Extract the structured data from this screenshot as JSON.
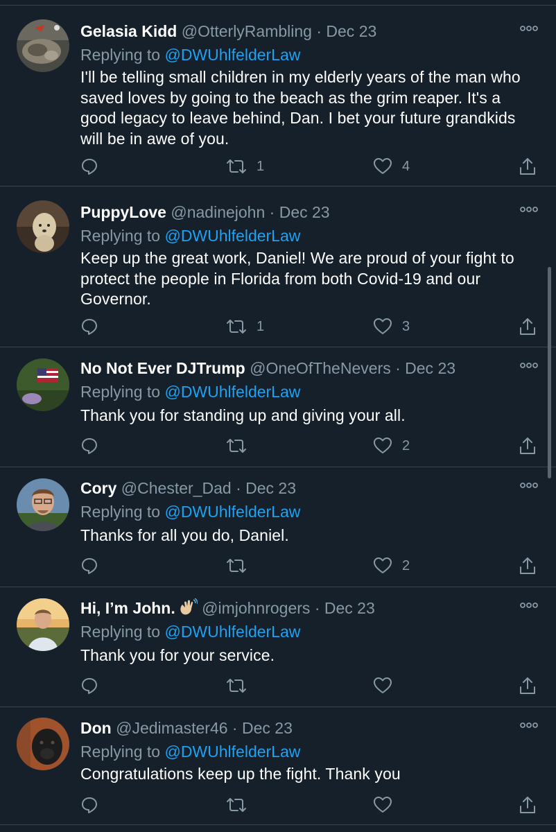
{
  "tweets": [
    {
      "name": "Gelasia Kidd",
      "handle": "@OtterlyRambling",
      "date": "Dec 23",
      "replying_prefix": "Replying to",
      "replying_to": "@DWUhlfelderLaw",
      "text": "I'll be telling small children in my elderly years of the man who saved loves by going to the beach as the grim reaper. It's a good legacy to leave behind, Dan. I bet your future grandkids will be in awe of you.",
      "retweets": "1",
      "likes": "4"
    },
    {
      "name": "PuppyLove",
      "handle": "@nadinejohn",
      "date": "Dec 23",
      "replying_prefix": "Replying to",
      "replying_to": "@DWUhlfelderLaw",
      "text": "Keep up the great work, Daniel! We are proud of your fight to protect the people in Florida from both Covid-19 and our Governor.",
      "retweets": "1",
      "likes": "3"
    },
    {
      "name": "No Not Ever DJTrump",
      "handle": "@OneOfTheNevers",
      "date": "Dec 23",
      "replying_prefix": "Replying to",
      "replying_to": "@DWUhlfelderLaw",
      "text": "Thank you for standing up and giving your all.",
      "retweets": "",
      "likes": "2"
    },
    {
      "name": "Cory",
      "handle": "@Chester_Dad",
      "date": "Dec 23",
      "replying_prefix": "Replying to",
      "replying_to": "@DWUhlfelderLaw",
      "text": "Thanks for all you do, Daniel.",
      "retweets": "",
      "likes": "2"
    },
    {
      "name": "Hi, I’m John.",
      "handle": "@imjohnrogers",
      "date": "Dec 23",
      "replying_prefix": "Replying to",
      "replying_to": "@DWUhlfelderLaw",
      "text": "Thank you for your service.",
      "retweets": "",
      "likes": ""
    },
    {
      "name": "Don",
      "handle": "@Jedimaster46",
      "date": "Dec 23",
      "replying_prefix": "Replying to",
      "replying_to": "@DWUhlfelderLaw",
      "text": "Congratulations keep up the fight.  Thank you",
      "retweets": "",
      "likes": ""
    }
  ],
  "separator": "·",
  "colors": {
    "background": "#15202b",
    "muted": "#8899a6",
    "link": "#1da1f2",
    "divider": "#38444d"
  },
  "icons": [
    "reply-icon",
    "retweet-icon",
    "like-icon",
    "share-icon",
    "more-icon",
    "waving-hand-icon"
  ]
}
